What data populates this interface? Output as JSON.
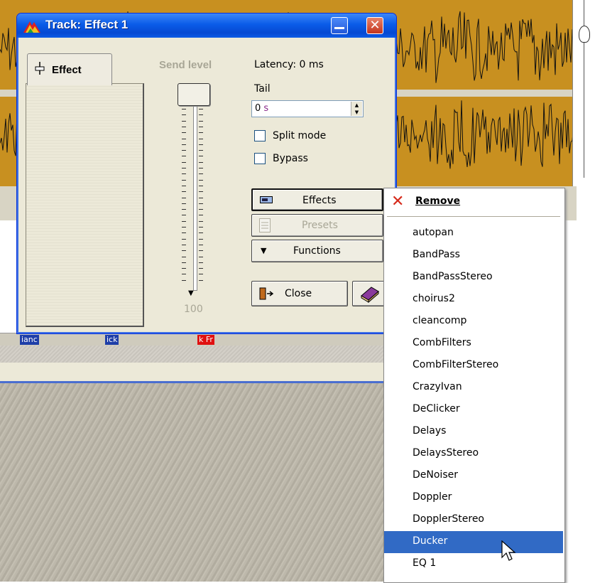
{
  "window": {
    "title": "Track: Effect 1",
    "tab_label": "Effect"
  },
  "send": {
    "label": "Send level",
    "value": "100"
  },
  "info": {
    "latency": "Latency: 0 ms",
    "tail_label": "Tail",
    "tail_value": "0",
    "tail_unit": "s"
  },
  "options": {
    "split_mode": "Split mode",
    "split_checked": false,
    "bypass": "Bypass",
    "bypass_checked": false
  },
  "buttons": {
    "effects": "Effects",
    "presets": "Presets",
    "functions": "Functions",
    "close": "Close"
  },
  "clips": [
    "ianc",
    "ick",
    "k Fr"
  ],
  "menu": {
    "remove": "Remove",
    "items": [
      "autopan",
      "BandPass",
      "BandPassStereo",
      "choirus2",
      "cleancomp",
      "CombFilters",
      "CombFilterStereo",
      "CrazyIvan",
      "DeClicker",
      "Delays",
      "DelaysStereo",
      "DeNoiser",
      "Doppler",
      "DopplerStereo",
      "Ducker",
      "EQ 1"
    ],
    "selected": "Ducker"
  },
  "colors": {
    "title_blue": "#0a5ce8",
    "wave_orange": "#c89020",
    "menu_highlight": "#316ac5",
    "remove_red": "#d62a1b"
  }
}
